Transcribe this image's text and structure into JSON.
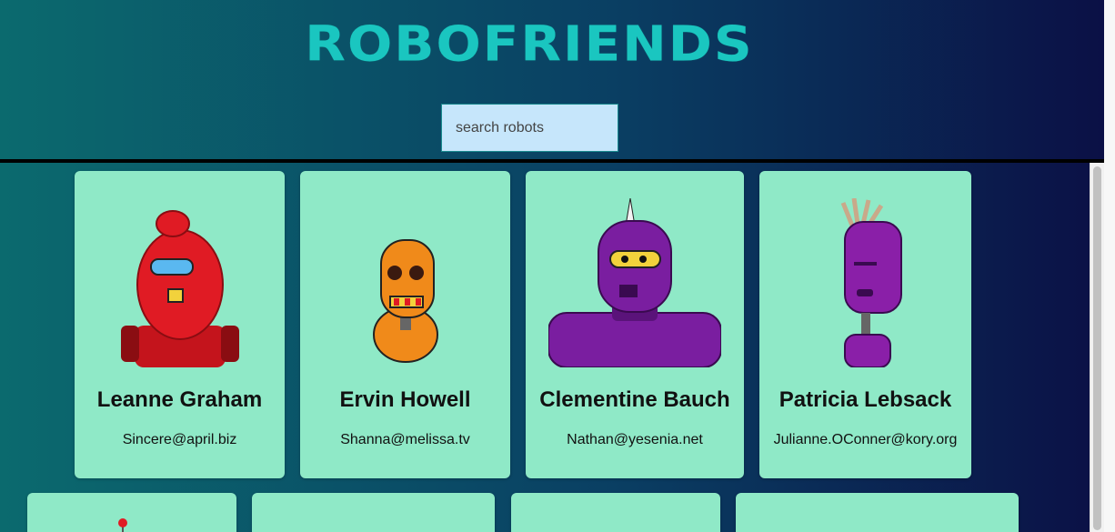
{
  "header": {
    "title": "ROBOFRIENDS"
  },
  "search": {
    "placeholder": "search robots",
    "value": ""
  },
  "robots": [
    {
      "name": "Leanne Graham",
      "email": "Sincere@april.biz",
      "color": "#e01b24"
    },
    {
      "name": "Ervin Howell",
      "email": "Shanna@melissa.tv",
      "color": "#f08a1a"
    },
    {
      "name": "Clementine Bauch",
      "email": "Nathan@yesenia.net",
      "color": "#7a1ea0"
    },
    {
      "name": "Patricia Lebsack",
      "email": "Julianne.OConner@kory.org",
      "color": "#8a1fa8"
    }
  ],
  "colors": {
    "card": "#8fe9c7",
    "title": "#1ac6c0",
    "search_bg": "#c6e6fb"
  }
}
